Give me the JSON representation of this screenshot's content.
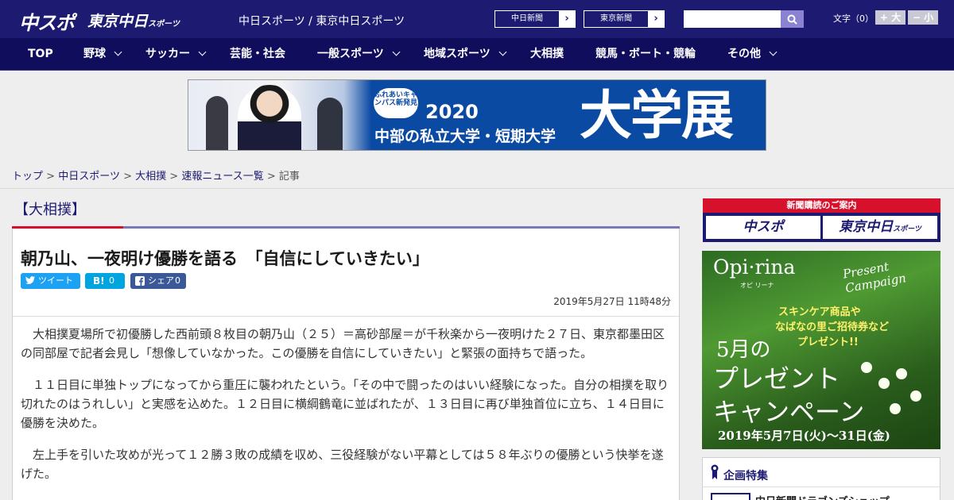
{
  "header": {
    "logo_chunichi": "中スポ",
    "logo_tokyo": "東京中日",
    "logo_tokyo_suffix": "スポーツ",
    "site_name": "中日スポーツ / 東京中日スポーツ",
    "paper_links": [
      {
        "label": "中日新聞",
        "arrow": "›"
      },
      {
        "label": "東京新聞",
        "arrow": "›"
      }
    ],
    "search_placeholder": "",
    "font_size_label": "文字（0）",
    "font_larger": "+ 大",
    "font_smaller": "− 小"
  },
  "nav": {
    "items": [
      {
        "label": "TOP"
      },
      {
        "label": "野球"
      },
      {
        "label": "サッカー"
      },
      {
        "label": "芸能・社会"
      },
      {
        "label": "一般スポーツ"
      },
      {
        "label": "地域スポーツ"
      },
      {
        "label": "大相撲"
      },
      {
        "label": "競馬・ボート・競輪"
      },
      {
        "label": "その他"
      }
    ]
  },
  "banner": {
    "badge": "ふれあいキャンパス新発見",
    "year": "2020",
    "subtitle": "中部の私立大学・短期大学",
    "big_text": "大学展"
  },
  "breadcrumb": {
    "items": [
      "トップ",
      "中日スポーツ",
      "大相撲",
      "速報ニュース一覧"
    ],
    "separator": ">",
    "current": "記事"
  },
  "article": {
    "category": "【大相撲】",
    "headline": "朝乃山、一夜明け優勝を語る　「自信にしていきたい」",
    "share": {
      "tweet_label": "ツイート",
      "hatena_label": "B!",
      "hatena_count": "0",
      "fb_label": "シェア",
      "fb_count": "0"
    },
    "date": "2019年5月27日 11時48分",
    "paragraphs": [
      "大相撲夏場所で初優勝した西前頭８枚目の朝乃山（２５）＝高砂部屋＝が千秋楽から一夜明けた２７日、東京都墨田区の同部屋で記者会見し「想像していなかった。この優勝を自信にしていきたい」と緊張の面持ちで語った。",
      "１１日目に単独トップになってから重圧に襲われたという。「その中で闘ったのはいい経験になった。自分の相撲を取り切れたのはうれしい」と実感を込めた。１２日目に横綱鶴竜に並ばれたが、１３日目に再び単独首位に立ち、１４日目に優勝を決めた。",
      "左上手を引いた攻めが光って１２勝３敗の成績を収め、三役経験がない平幕としては５８年ぶりの優勝という快挙を遂げた。"
    ]
  },
  "sidebar": {
    "subscribe": {
      "heading": "新聞購読のご案内",
      "chunichi": "中スポ",
      "tokyo": "東京中日",
      "tokyo_suffix": "スポーツ"
    },
    "promo": {
      "brand": "Opi·rina",
      "brand_sub": "オピ リーナ",
      "tagline": "Present Campaign",
      "copy1": "スキンケア商品や",
      "copy2": "なばなの里ご招待券など",
      "copy3": "プレゼント!!",
      "month": "5月の",
      "title1": "プレゼント",
      "title2": "キャンペーン",
      "dates": "2019年5月7日(火)〜31日(金)"
    },
    "feature": {
      "title": "企画特集",
      "item": "中日新聞ドラゴンズショップ"
    }
  },
  "colors": {
    "header_bg": "#1d1a72",
    "nav_bg": "#100e5c",
    "accent_red": "#d7102b"
  }
}
